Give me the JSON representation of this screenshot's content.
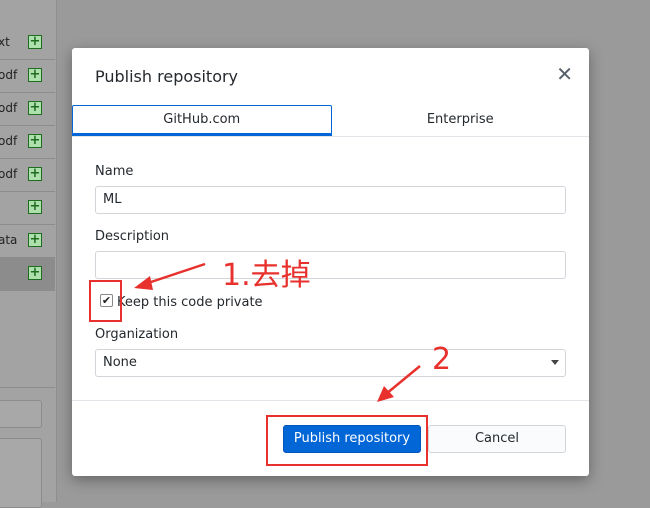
{
  "background": {
    "rows": [
      {
        "text": "xt"
      },
      {
        "text": "odf"
      },
      {
        "text": "odf"
      },
      {
        "text": "odf"
      },
      {
        "text": "odf"
      },
      {
        "text": ""
      },
      {
        "text": "ata"
      },
      {
        "text": ""
      }
    ],
    "plus_symbol": "+"
  },
  "dialog": {
    "title": "Publish repository",
    "close_symbol": "✕",
    "tabs": [
      {
        "label": "GitHub.com",
        "active": true
      },
      {
        "label": "Enterprise",
        "active": false
      }
    ],
    "name_label": "Name",
    "name_value": "ML",
    "description_label": "Description",
    "description_value": "",
    "private_label": "Keep this code private",
    "private_checked": true,
    "checkbox_mark": "✔",
    "organization_label": "Organization",
    "organization_value": "None",
    "publish_label": "Publish repository",
    "cancel_label": "Cancel"
  },
  "annotations": {
    "step1": "1.去掉",
    "step2": "2"
  },
  "colors": {
    "accent": "#0366d6",
    "annotation": "#e8302c"
  }
}
